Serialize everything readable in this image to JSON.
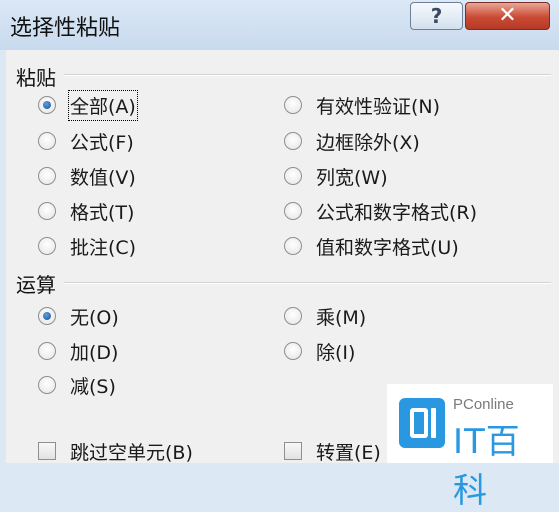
{
  "window": {
    "title": "选择性粘贴",
    "help_glyph": "?",
    "close_glyph": "✕"
  },
  "paste_group": {
    "label": "粘贴",
    "options": [
      {
        "label": "全部(A)",
        "checked": true
      },
      {
        "label": "公式(F)",
        "checked": false
      },
      {
        "label": "数值(V)",
        "checked": false
      },
      {
        "label": "格式(T)",
        "checked": false
      },
      {
        "label": "批注(C)",
        "checked": false
      },
      {
        "label": "有效性验证(N)",
        "checked": false
      },
      {
        "label": "边框除外(X)",
        "checked": false
      },
      {
        "label": "列宽(W)",
        "checked": false
      },
      {
        "label": "公式和数字格式(R)",
        "checked": false
      },
      {
        "label": "值和数字格式(U)",
        "checked": false
      }
    ]
  },
  "operation_group": {
    "label": "运算",
    "options": [
      {
        "label": "无(O)",
        "checked": true
      },
      {
        "label": "加(D)",
        "checked": false
      },
      {
        "label": "减(S)",
        "checked": false
      },
      {
        "label": "乘(M)",
        "checked": false
      },
      {
        "label": "除(I)",
        "checked": false
      }
    ]
  },
  "checkboxes": {
    "skip_blanks": {
      "label": "跳过空单元(B)",
      "checked": false
    },
    "transpose": {
      "label": "转置(E)",
      "checked": false
    }
  },
  "watermark": {
    "small_text": "PConline",
    "big_text": "IT百科"
  }
}
